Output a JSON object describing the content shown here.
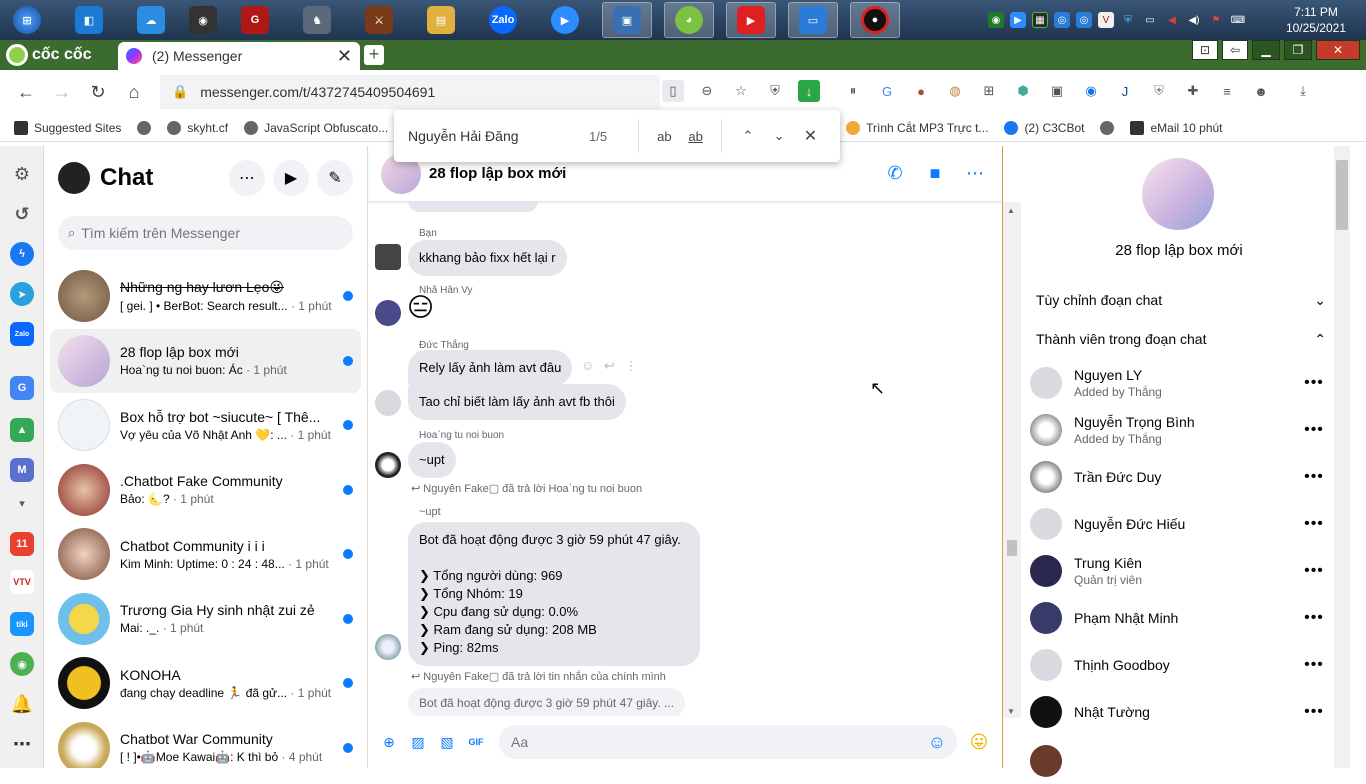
{
  "taskbar": {
    "apps": [
      {
        "name": "start",
        "color": "#2a76c6",
        "glyph": "⊞"
      },
      {
        "name": "vscode",
        "color": "#1a7ad4",
        "glyph": "◧"
      },
      {
        "name": "onedrive",
        "color": "#2b8de0",
        "glyph": "☁"
      },
      {
        "name": "obs",
        "color": "#333333",
        "glyph": "◉"
      },
      {
        "name": "garena",
        "color": "#b01818",
        "glyph": "G"
      },
      {
        "name": "game",
        "color": "#5a6a7a",
        "glyph": "♞"
      },
      {
        "name": "game2",
        "color": "#7a3a1a",
        "glyph": "⚔"
      },
      {
        "name": "explorer",
        "color": "#e0b040",
        "glyph": "▤"
      },
      {
        "name": "zalo",
        "color": "#0a68ff",
        "glyph": "Zalo"
      },
      {
        "name": "zoom",
        "color": "#2d8cff",
        "glyph": "▶"
      },
      {
        "name": "remote",
        "color": "#3a6fb0",
        "glyph": "▣"
      },
      {
        "name": "coccoc",
        "color": "#7cc242",
        "glyph": "◕"
      },
      {
        "name": "youtube",
        "color": "#e02020",
        "glyph": "▶"
      },
      {
        "name": "display",
        "color": "#2b7bd8",
        "glyph": "▭"
      },
      {
        "name": "record",
        "color": "#111111",
        "glyph": "●"
      }
    ],
    "clock_time": "7:11 PM",
    "clock_date": "10/25/2021"
  },
  "browser": {
    "brand": "cốc cốc",
    "tab_title": "(2) Messenger",
    "url": "messenger.com/t/4372745409504691",
    "bookmarks": [
      {
        "label": "Suggested Sites"
      },
      {
        "label": "skyht.cf"
      },
      {
        "label": "JavaScript Obfuscato..."
      },
      {
        "label": "Trình Cắt MP3 Trực t..."
      },
      {
        "label": "(2) C3CBot"
      },
      {
        "label": "eMail 10 phút"
      }
    ],
    "find": {
      "query": "Nguyễn Hải Đăng",
      "count": "1/5"
    }
  },
  "chatlist": {
    "title": "Chat",
    "search_placeholder": "Tìm kiếm trên Messenger",
    "items": [
      {
        "name": "Những ng hay lươn Lẹo😜",
        "preview": "[ gei. ] • BerBot: Search result...",
        "time": " · 1 phút",
        "color": "#8a7055"
      },
      {
        "name": "28 flop lập box mới",
        "preview": "Hoa`ng tu noi buon: Ác",
        "time": " · 1 phút",
        "color": "#cbb6dc"
      },
      {
        "name": "Box hỗ trợ bot ~siucute~ [ Thê...",
        "preview": "Vợ yêu của Võ Nhật Anh 💛: ...",
        "time": " · 1 phút",
        "color": "#eef4f7"
      },
      {
        "name": ".Chatbot Fake Community",
        "preview": "Bảo: 🌜?",
        "time": " · 1 phút",
        "color": "#b0504a"
      },
      {
        "name": "Chatbot Community i i i",
        "preview": "Kim Minh: Uptime: 0 : 24 : 48...",
        "time": " · 1 phút",
        "color": "#9a6a55"
      },
      {
        "name": "Trương Gia Hy sinh nhật zui zẻ",
        "preview": "Mai: ._.",
        "time": " · 1 phút",
        "color": "#6ec0ea"
      },
      {
        "name": "KONOHA",
        "preview": "đang chạy deadline 🏃 đã gử...",
        "time": " · 1 phút",
        "color": "#e8b020"
      },
      {
        "name": "Chatbot War Community",
        "preview": "[ ! ]•🤖Moe Kawai🤖: K thì bỏ",
        "time": " · 4 phút",
        "color": "#c9a85a"
      }
    ]
  },
  "conversation": {
    "title": "28 flop lập box mới",
    "messages": [
      {
        "sender": "Bạn",
        "text": "kkhang bảo fixx hết lại r"
      },
      {
        "sender": "Nhã Hân Vy",
        "text": "😑"
      },
      {
        "sender": "Đức Thắng",
        "text": "Rely lấy ảnh làm avt đâu"
      },
      {
        "sender": "",
        "text": "Tao chỉ biết làm lấy ảnh avt fb thôi"
      },
      {
        "sender": "Hoa`ng tu noi buon",
        "text": "~upt"
      },
      {
        "sender": "Nguyên Fake▢ đã trả lời Hoa`ng tu noi buon",
        "text": "~upt"
      },
      {
        "sender": "",
        "text": "Bot đã hoạt động được 3 giờ 59 phút 47 giây.\n\n❯ Tổng người dùng: 969\n❯ Tổng Nhóm: 19\n❯ Cpu đang sử dụng: 0.0%\n❯ Ram đang sử dụng: 208 MB\n❯ Ping: 82ms"
      },
      {
        "sender": "Nguyên Fake▢ đã trả lời tin nhắn của chính mình",
        "text": "Bot đã hoạt động được 3 giờ 59 phút 47 giây. ..."
      }
    ],
    "composer_placeholder": "Aa"
  },
  "info": {
    "name": "28 flop lập box mới",
    "customize": "Tùy chỉnh đoạn chat",
    "members_label": "Thành viên trong đoạn chat",
    "members": [
      {
        "name": "Nguyen LY",
        "sub": "Added by Thắng",
        "color": "#d8dadf"
      },
      {
        "name": "Nguyễn Trọng Bình",
        "sub": "Added by Thắng",
        "color": "#b8b8b8"
      },
      {
        "name": "Trần Đức Duy",
        "sub": "",
        "color": "#c8c8c8"
      },
      {
        "name": "Nguyễn Đức Hiếu",
        "sub": "",
        "color": "#d8dadf"
      },
      {
        "name": "Trung Kiên",
        "sub": "Quản trị viên",
        "color": "#2a2850"
      },
      {
        "name": "Phạm Nhật Minh",
        "sub": "",
        "color": "#3a3a6a"
      },
      {
        "name": "Thịnh Goodboy",
        "sub": "",
        "color": "#d8dadf"
      },
      {
        "name": "Nhật Tường",
        "sub": "",
        "color": "#111111"
      }
    ]
  }
}
